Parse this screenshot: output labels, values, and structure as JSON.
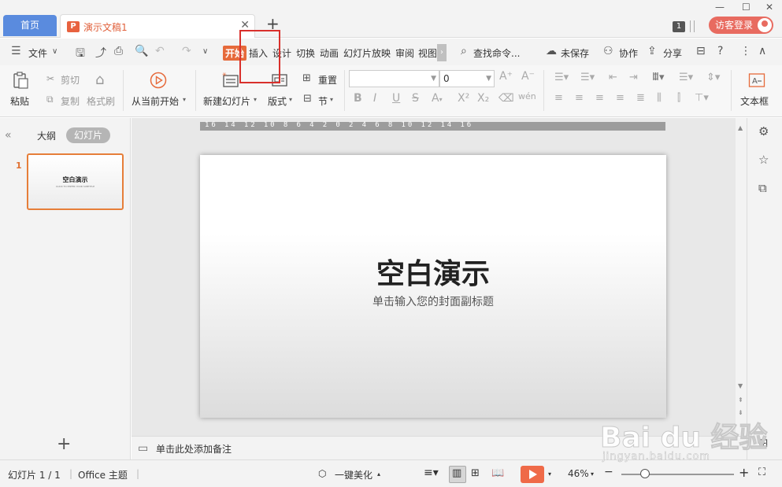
{
  "titlebar": {
    "home_tab": "首页",
    "doc_tab": "演示文稿1",
    "doc_icon": "P",
    "badge": "1",
    "login": "访客登录"
  },
  "menubar": {
    "file": "文件",
    "tabs": [
      "开始",
      "插入",
      "设计",
      "切换",
      "动画",
      "幻灯片放映",
      "审阅",
      "视图"
    ],
    "active_tab": "开始",
    "search": "查找命令...",
    "unsaved": "未保存",
    "collab": "协作",
    "share": "分享"
  },
  "ribbon": {
    "paste": "粘贴",
    "cut": "剪切",
    "copy": "复制",
    "format_painter": "格式刷",
    "play_from_current": "从当前开始",
    "new_slide": "新建幻灯片",
    "layout": "版式",
    "reset": "重置",
    "section": "节",
    "font_size": "0",
    "textbox": "文本框"
  },
  "left_panel": {
    "outline": "大纲",
    "slides": "幻灯片",
    "slide_number": "1",
    "thumb_title": "空白演示",
    "thumb_sub": "CLICK TO ENTER YOUR SUBTITLE"
  },
  "ruler": "16 14 12 10 8 6 4 2 0 2 4 6 8 10 12 14 16",
  "slide": {
    "title": "空白演示",
    "subtitle": "单击输入您的封面副标题"
  },
  "notes": "单击此处添加备注",
  "statusbar": {
    "slide_pos": "幻灯片 1 / 1",
    "theme": "Office 主题",
    "beautify": "一键美化",
    "zoom": "46%"
  },
  "watermark": {
    "brand": "Bai du 经验",
    "url": "jingyan.baidu.com"
  },
  "colors": {
    "accent": "#e66a3b",
    "home_tab": "#5a8bde",
    "login_btn": "#e86b60",
    "highlight_box": "#d9302c"
  }
}
